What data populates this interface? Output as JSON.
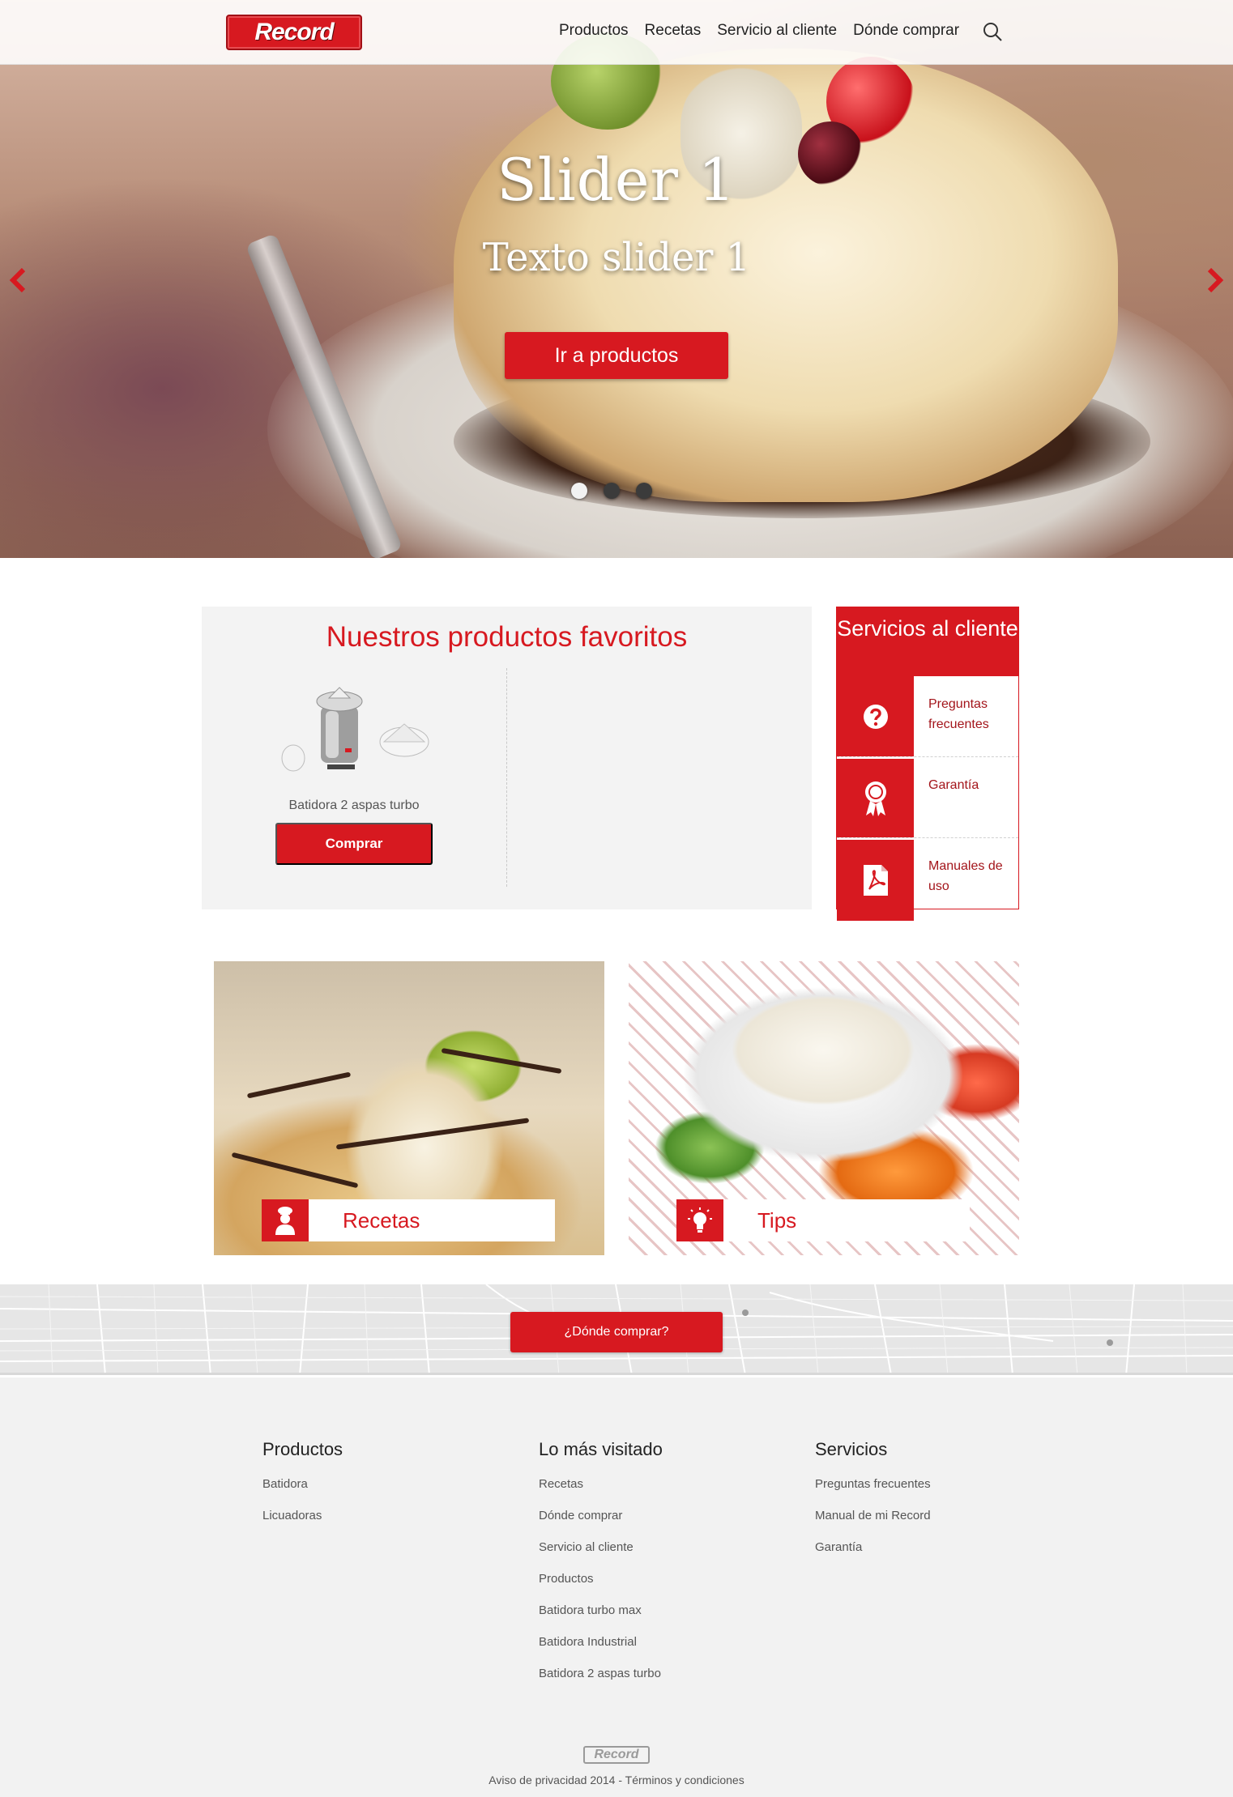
{
  "header": {
    "logo_text": "Record",
    "nav": [
      "Productos",
      "Recetas",
      "Servicio al cliente",
      "Dónde comprar"
    ]
  },
  "hero": {
    "title": "Slider 1",
    "subtitle": "Texto slider 1",
    "button": "Ir a productos",
    "slides_count": 3,
    "active_slide": 1
  },
  "favorites": {
    "title": "Nuestros productos favoritos",
    "product_name": "Batidora 2 aspas turbo",
    "buy_label": "Comprar"
  },
  "services": {
    "title": "Servicios al cliente",
    "items": [
      {
        "label": "Preguntas frecuentes",
        "icon": "question-icon"
      },
      {
        "label": "Garantía",
        "icon": "award-ribbon-icon"
      },
      {
        "label": "Manuales de uso",
        "icon": "pdf-icon"
      }
    ]
  },
  "cards": {
    "recetas": {
      "label": "Recetas",
      "icon": "chef-icon"
    },
    "tips": {
      "label": "Tips",
      "icon": "lightbulb-icon"
    }
  },
  "map": {
    "button": "¿Dónde comprar?"
  },
  "footer": {
    "col1": {
      "title": "Productos",
      "links": [
        "Batidora",
        "Licuadoras"
      ]
    },
    "col2": {
      "title": "Lo más visitado",
      "links": [
        "Recetas",
        "Dónde comprar",
        "Servicio al cliente",
        "Productos",
        "Batidora turbo max",
        "Batidora Industrial",
        "Batidora 2 aspas turbo"
      ]
    },
    "col3": {
      "title": "Servicios",
      "links": [
        "Preguntas frecuentes",
        "Manual de mi Record",
        "Garantía"
      ]
    },
    "logo_text": "Record",
    "copyright": "Aviso de privacidad 2014 - Términos y condiciones"
  },
  "colors": {
    "accent": "#d71920",
    "footer_bg": "#f2f2f2"
  }
}
